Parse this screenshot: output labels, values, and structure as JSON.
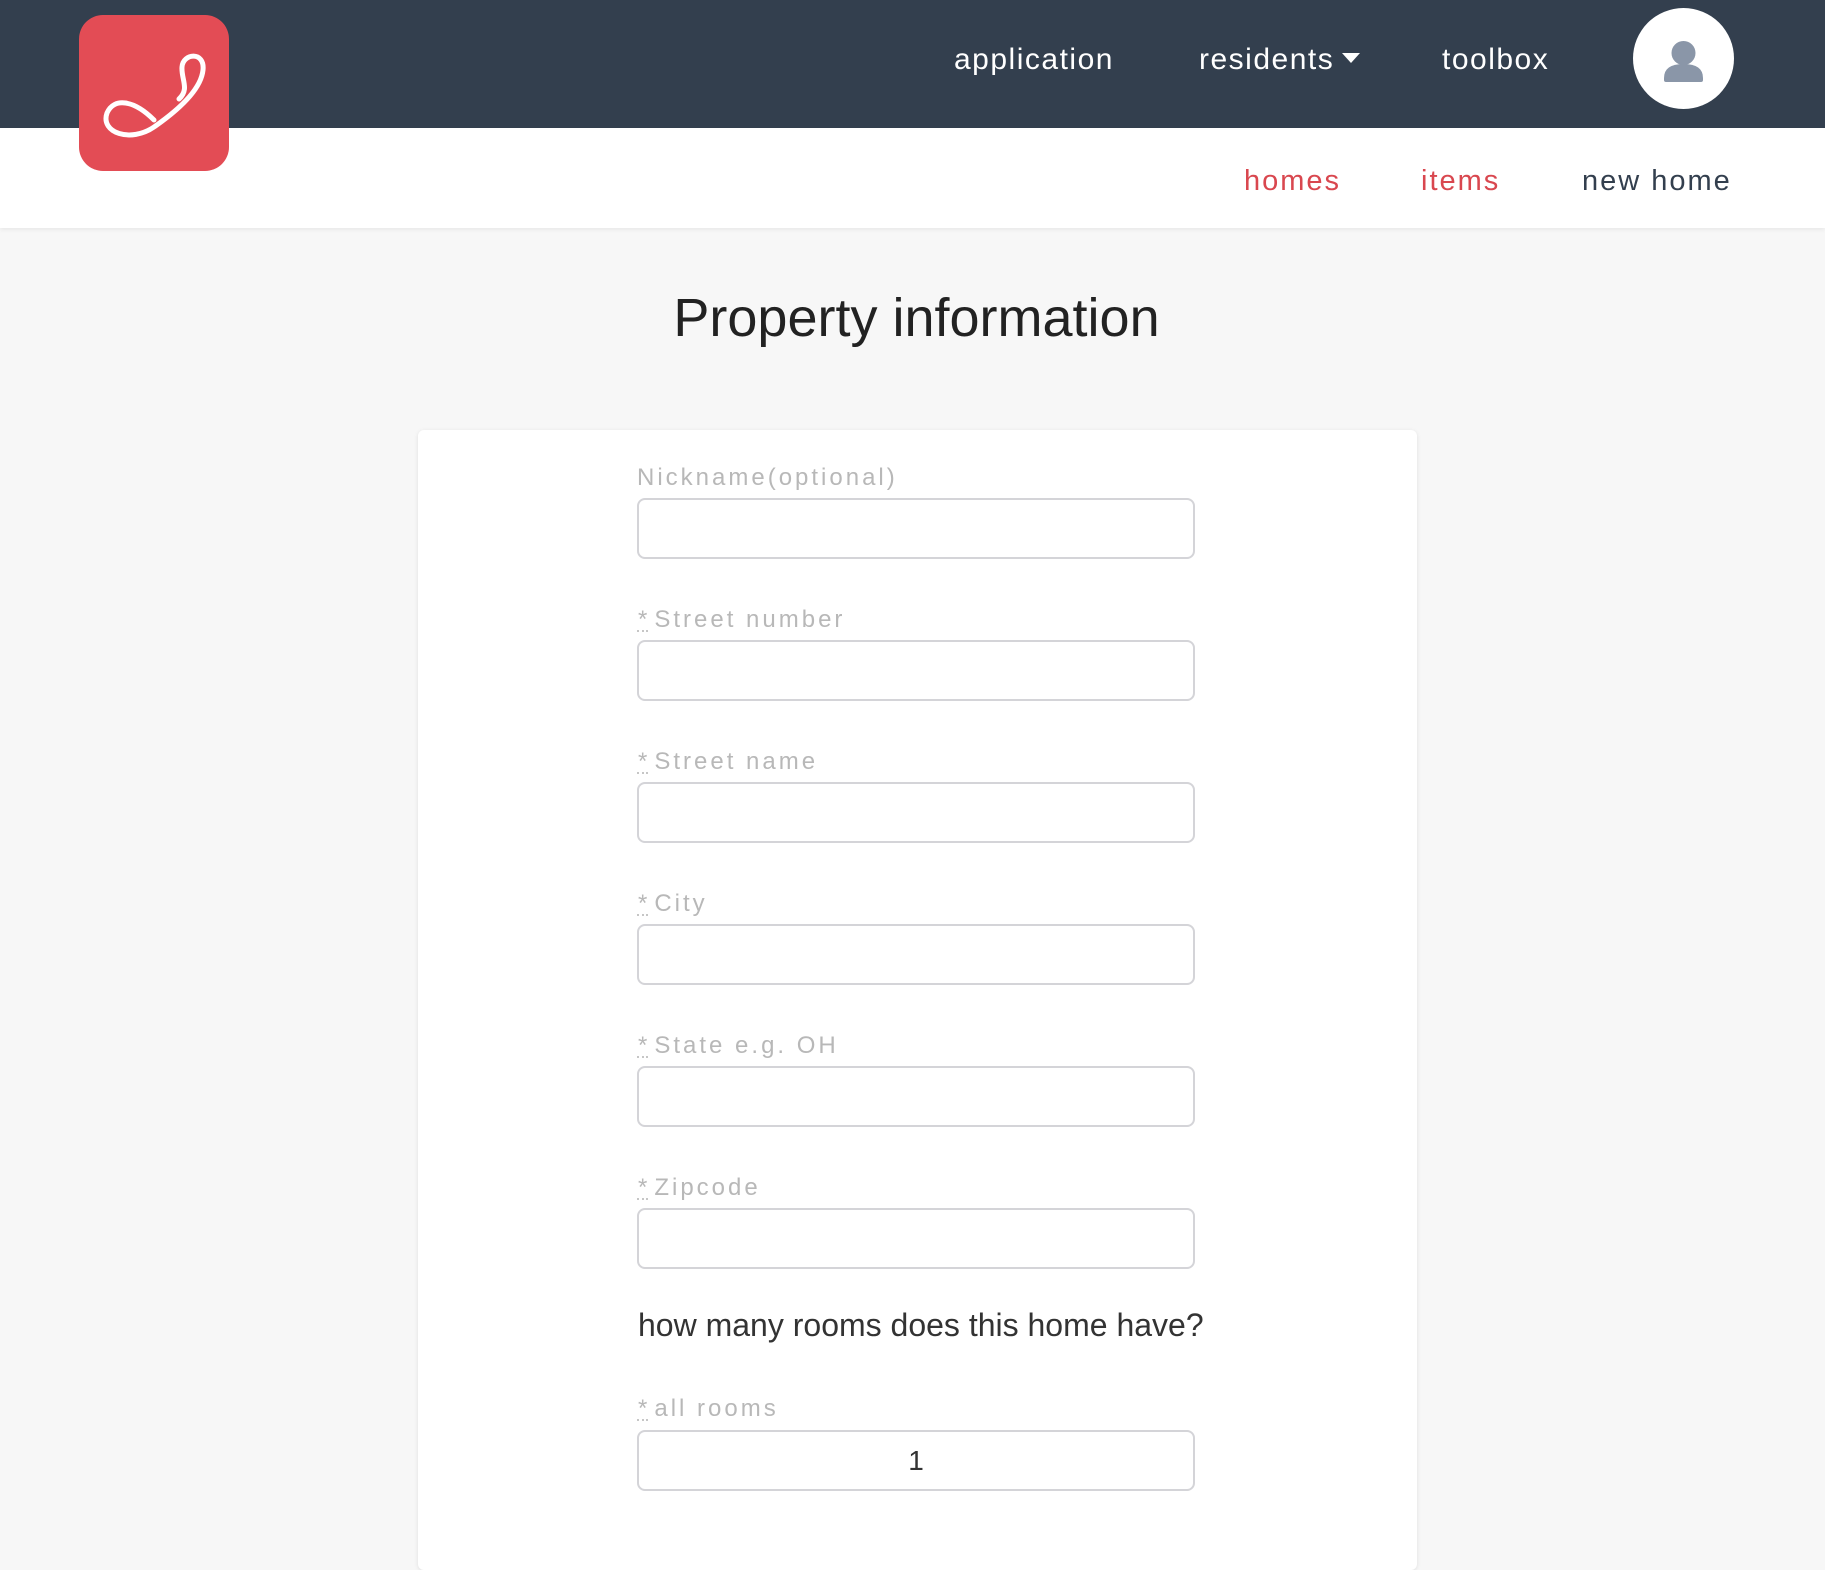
{
  "header": {
    "nav": [
      "application",
      "residents",
      "toolbox"
    ],
    "logo_icon": "swirl-logo-icon",
    "avatar_icon": "user-icon"
  },
  "subnav": [
    "homes",
    "items",
    "new home"
  ],
  "page": {
    "title": "Property information"
  },
  "form": {
    "required_mark": "*",
    "nickname": {
      "label": "Nickname(optional)",
      "value": ""
    },
    "street_number": {
      "label": "Street number",
      "value": ""
    },
    "street_name": {
      "label": "Street name",
      "value": ""
    },
    "city": {
      "label": "City",
      "value": ""
    },
    "state": {
      "label": "State e.g. OH",
      "value": ""
    },
    "zipcode": {
      "label": "Zipcode",
      "value": ""
    },
    "rooms_question": "how many rooms does this home have?",
    "all_rooms": {
      "label": "all rooms",
      "value": "1"
    }
  },
  "colors": {
    "header_bg": "#333f4e",
    "accent": "#e34c55",
    "subnav_active": "#d9474f",
    "subnav_default": "#333f4e"
  }
}
